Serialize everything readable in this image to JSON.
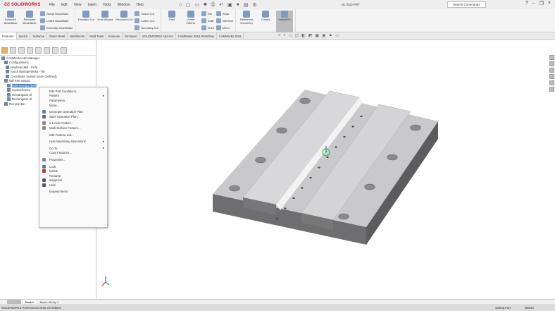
{
  "app": {
    "logo": "SOLIDWORKS",
    "doc_title": "DL SLD.PRT",
    "search_placeholder": "Search Commands"
  },
  "menu": [
    "File",
    "Edit",
    "View",
    "Insert",
    "Tools",
    "Window",
    "Help"
  ],
  "ribbon": {
    "big": [
      "Extruded Boss/Base",
      "Revolved Boss/Base"
    ],
    "boss_small": [
      "Swept Boss/Base",
      "Lofted Boss/Base",
      "Boundary Boss/Base"
    ],
    "cut_big": [
      "Extruded Cut",
      "Hole Wizard",
      "Revolved Cut"
    ],
    "cut_small": [
      "Swept Cut",
      "Lofted Cut",
      "Boundary Cut"
    ],
    "feat_big": [
      "Fillet",
      "Linear Pattern"
    ],
    "feat_small1": [
      "Rib",
      "Draft",
      "Shell"
    ],
    "feat_small2": [
      "Wrap",
      "Intersect",
      "Mirror"
    ],
    "ref": [
      "Reference Geometry",
      "Curves",
      "Instant3D"
    ]
  },
  "cm_tabs": [
    "Features",
    "Sketch",
    "Surfaces",
    "Sheet Metal",
    "Weldments",
    "Mold Tools",
    "Evaluate",
    "DimXpert",
    "SOLIDWORKS Add-Ins",
    "CAMWorks 2018 WorkFlow",
    "CAMWorks 2018"
  ],
  "tree": [
    "CAMWorks NC Manager",
    "Configurations",
    "Machine [Mill - Inch]",
    "Stock Manager[6061 -T6]",
    "Coordinate System (User Defined)",
    "Mill Part Setup1",
    "Hole Group1 [Drill]",
    "Counterbore1",
    "Rectangular Sl",
    "Rectangular Sl",
    "Recycle Bin"
  ],
  "context_menu": [
    {
      "label": "Edit Part Conditions..."
    },
    {
      "label": "Pattern",
      "sub": true
    },
    {
      "label": "Parameters..."
    },
    {
      "label": "Move..."
    },
    {
      "sep": true
    },
    {
      "label": "Generate Operation Plan",
      "icon": "#5a7fa8"
    },
    {
      "label": "Save Operation Plan...",
      "icon": "#667"
    },
    {
      "sep": true
    },
    {
      "label": "2.5 Axis Feature...",
      "icon": "#888"
    },
    {
      "label": "Multi Surface Feature...",
      "icon": "#888"
    },
    {
      "sep": true
    },
    {
      "label": "Edit Feature List..."
    },
    {
      "sep": true
    },
    {
      "label": "Hole Machining Operations",
      "sub": true
    },
    {
      "sep": true
    },
    {
      "label": "Go To",
      "sub": true
    },
    {
      "label": "Copy Features..."
    },
    {
      "sep": true
    },
    {
      "label": "Properties...",
      "icon": "#888"
    },
    {
      "sep": true
    },
    {
      "label": "Lock",
      "icon": "#4a78b8"
    },
    {
      "label": "Delete",
      "icon": "#d03030"
    },
    {
      "label": "Rename"
    },
    {
      "label": "Suppress",
      "icon": "#556"
    },
    {
      "label": "Hide",
      "icon": "#556"
    },
    {
      "sep": true
    },
    {
      "label": "Expand Items"
    }
  ],
  "bottom_tabs": [
    "Model",
    "Motion Study 1"
  ],
  "status": {
    "left": "SOLIDWORKS Professional 2018 x64 Edition",
    "editing": "Editing Part",
    "units": "MMGS"
  }
}
